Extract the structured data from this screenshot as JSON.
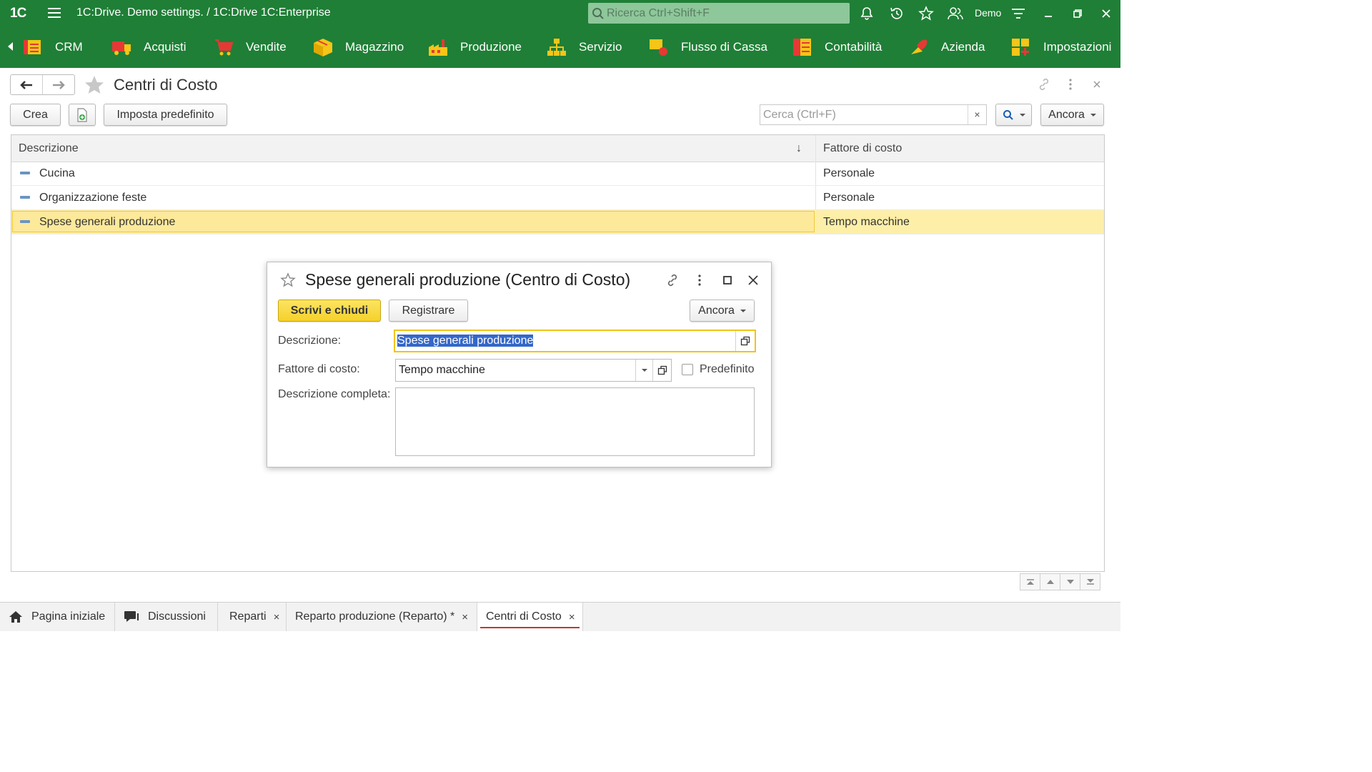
{
  "titlebar": {
    "logo": "1C",
    "title": "1C:Drive. Demo settings. / 1C:Drive 1C:Enterprise",
    "search_placeholder": "Ricerca Ctrl+Shift+F",
    "user": "Demo",
    "icons": [
      "bell-icon",
      "history-icon",
      "star-icon",
      "users-icon",
      "filter-icon",
      "minimize-icon",
      "restore-icon",
      "close-icon"
    ]
  },
  "sections": [
    {
      "label": "CRM",
      "icon": "crm-icon",
      "color": "#f5c518"
    },
    {
      "label": "Acquisti",
      "icon": "truck-icon",
      "color": "#e53935"
    },
    {
      "label": "Vendite",
      "icon": "cart-icon",
      "color": "#e53935"
    },
    {
      "label": "Magazzino",
      "icon": "box-icon",
      "color": "#f5c518"
    },
    {
      "label": "Produzione",
      "icon": "factory-icon",
      "color": "#f5c518"
    },
    {
      "label": "Servizio",
      "icon": "hierarchy-icon",
      "color": "#f5c518"
    },
    {
      "label": "Flusso di Cassa",
      "icon": "cash-icon",
      "color": "#f5c518"
    },
    {
      "label": "Contabilità",
      "icon": "ledger-icon",
      "color": "#f5c518"
    },
    {
      "label": "Azienda",
      "icon": "company-icon",
      "color": "#e53935"
    },
    {
      "label": "Impostazioni",
      "icon": "settings-grid-icon",
      "color": "#f5c518"
    }
  ],
  "page": {
    "title": "Centri di Costo",
    "buttons": {
      "create": "Crea",
      "set_default": "Imposta predefinito",
      "more": "Ancora"
    },
    "search_placeholder": "Cerca (Ctrl+F)",
    "search_clear": "×"
  },
  "table": {
    "columns": [
      "Descrizione",
      "Fattore di costo"
    ],
    "sort_indicator": "↓",
    "rows": [
      {
        "description": "Cucina",
        "cost_factor": "Personale",
        "selected": false
      },
      {
        "description": "Organizzazione feste",
        "cost_factor": "Personale",
        "selected": false
      },
      {
        "description": "Spese generali produzione",
        "cost_factor": "Tempo macchine",
        "selected": true
      }
    ]
  },
  "dialog": {
    "title": "Spese generali produzione (Centro di Costo)",
    "buttons": {
      "save_close": "Scrivi e chiudi",
      "save": "Registrare",
      "more": "Ancora"
    },
    "fields": {
      "description_label": "Descrizione:",
      "description_value": "Spese generali produzione",
      "cost_factor_label": "Fattore di costo:",
      "cost_factor_value": "Tempo macchine",
      "default_label": "Predefinito",
      "default_checked": false,
      "full_description_label": "Descrizione completa:",
      "full_description_value": ""
    }
  },
  "tabs": [
    {
      "label": "Pagina iniziale",
      "icon": "home-icon",
      "closable": false,
      "active": false
    },
    {
      "label": "Discussioni",
      "icon": "chat-icon",
      "closable": false,
      "active": false
    },
    {
      "label": "Reparti",
      "closable": true,
      "active": false
    },
    {
      "label": "Reparto produzione (Reparto) *",
      "closable": true,
      "active": false
    },
    {
      "label": "Centri di Costo",
      "closable": true,
      "active": true
    }
  ],
  "close_glyph": "×"
}
